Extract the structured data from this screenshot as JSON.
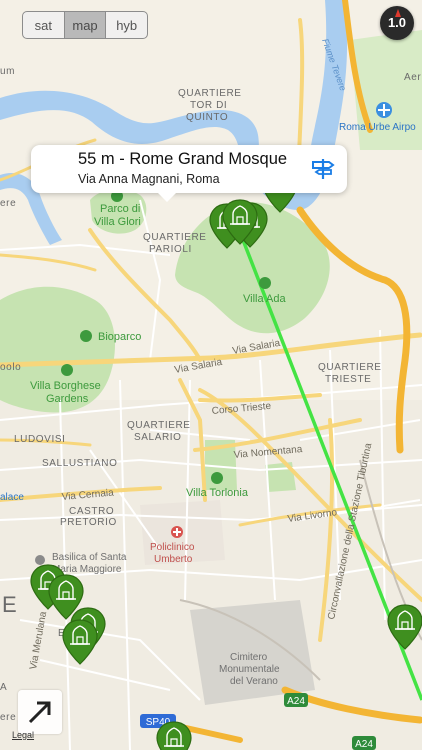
{
  "map_type_control": {
    "options": [
      "sat",
      "map",
      "hyb"
    ],
    "selected": "map"
  },
  "compass": {
    "value": "1.0"
  },
  "callout": {
    "title": "55 m - Rome Grand Mosque",
    "subtitle": "Via Anna Magnani, Roma",
    "accessory_icon": "directions-sign-icon"
  },
  "map_labels": {
    "quartiere_tor_di_quinto": [
      "QUARTIERE",
      "TOR DI",
      "QUINTO"
    ],
    "fiume_tevere": "Fiume Tevere",
    "roma_urbe_airport": "Roma Urbe Airpo",
    "parco_villa_glori": [
      "Parco di",
      "Villa Glori"
    ],
    "quartiere_parioli": [
      "QUARTIERE",
      "PARIOLI"
    ],
    "villa_ada": "Villa Ada",
    "bioparco": "Bioparco",
    "villa_borghese": [
      "Villa Borghese",
      "Gardens"
    ],
    "via_salaria_1": "Via Salaria",
    "via_salaria_2": "Via Salaria",
    "quartiere_trieste": [
      "QUARTIERE",
      "TRIESTE"
    ],
    "corso_trieste": "Corso Trieste",
    "quartiere_salario": [
      "QUARTIERE",
      "SALARIO"
    ],
    "ludovisi": "LUDOVISI",
    "sallustiano": "SALLUSTIANO",
    "via_nomentana": "Via Nomentana",
    "villa_torlonia": "Villa Torlonia",
    "via_cernaia": "Via Cernaia",
    "castro_pretorio": [
      "CASTRO",
      "PRETORIO"
    ],
    "via_livorno": "Via Livorno",
    "policlinico_umberto": [
      "Policlinico",
      "Umberto"
    ],
    "basilica": [
      "Basilica of Santa",
      "Maria Maggiore"
    ],
    "circonvallazione": "Circonvallazione della Stazione Tiburtina",
    "cimitero": [
      "Cimitero",
      "Monumentale",
      "del Verano"
    ],
    "via_merulana": "Via Merulana",
    "a24_shield_1": "A24",
    "a24_shield_2": "A24",
    "sp_shield": "SP40",
    "edge_labels": [
      "um",
      "ere",
      "oolo",
      "alace",
      "E",
      "ESQ",
      "A",
      "ere",
      "Aer"
    ]
  },
  "markers": {
    "icon": "mosque-pin-icon",
    "color": "#3f8f1f"
  },
  "route_line": {
    "color": "#44e344"
  },
  "legal_link": "Legal",
  "expand_button": {
    "icon": "expand-arrow-icon"
  }
}
